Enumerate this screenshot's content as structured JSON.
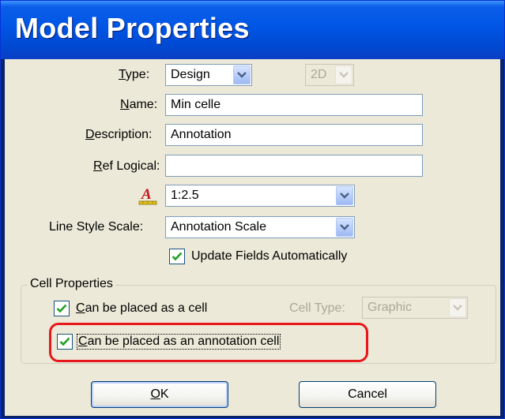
{
  "window": {
    "title": "Model Properties"
  },
  "type": {
    "label_mn": "T",
    "label_rest": "ype:",
    "value": "Design",
    "dim_value": "2D"
  },
  "name": {
    "label_mn": "N",
    "label_rest": "ame:",
    "value": "Min celle"
  },
  "description": {
    "label_mn": "D",
    "label_rest": "escription:",
    "value": "Annotation"
  },
  "ref_logical": {
    "label_mn": "R",
    "label_rest": "ef Logical:",
    "value": ""
  },
  "annotation_scale": {
    "icon": "annotation-scale-icon",
    "value": "1:2.5"
  },
  "line_style_scale": {
    "label": "Line Style Scale:",
    "value": "Annotation Scale"
  },
  "update_fields": {
    "label": "Update Fields Automatically",
    "checked": true
  },
  "cell_properties": {
    "group_title": "Cell Properties",
    "placed_as_cell": {
      "label_mn": "C",
      "label_rest": "an be placed as a cell",
      "checked": true
    },
    "cell_type": {
      "label": "Cell Type:",
      "value": "Graphic"
    },
    "placed_as_annotation": {
      "label_mn": "C",
      "label_rest": "an be placed as an annotation cell",
      "checked": true
    }
  },
  "buttons": {
    "ok_mn": "O",
    "ok_rest": "K",
    "cancel": "Cancel"
  },
  "colors": {
    "title_bar": "#0055e5",
    "highlight": "#e8171b",
    "dialog_bg": "#ece9d8"
  }
}
